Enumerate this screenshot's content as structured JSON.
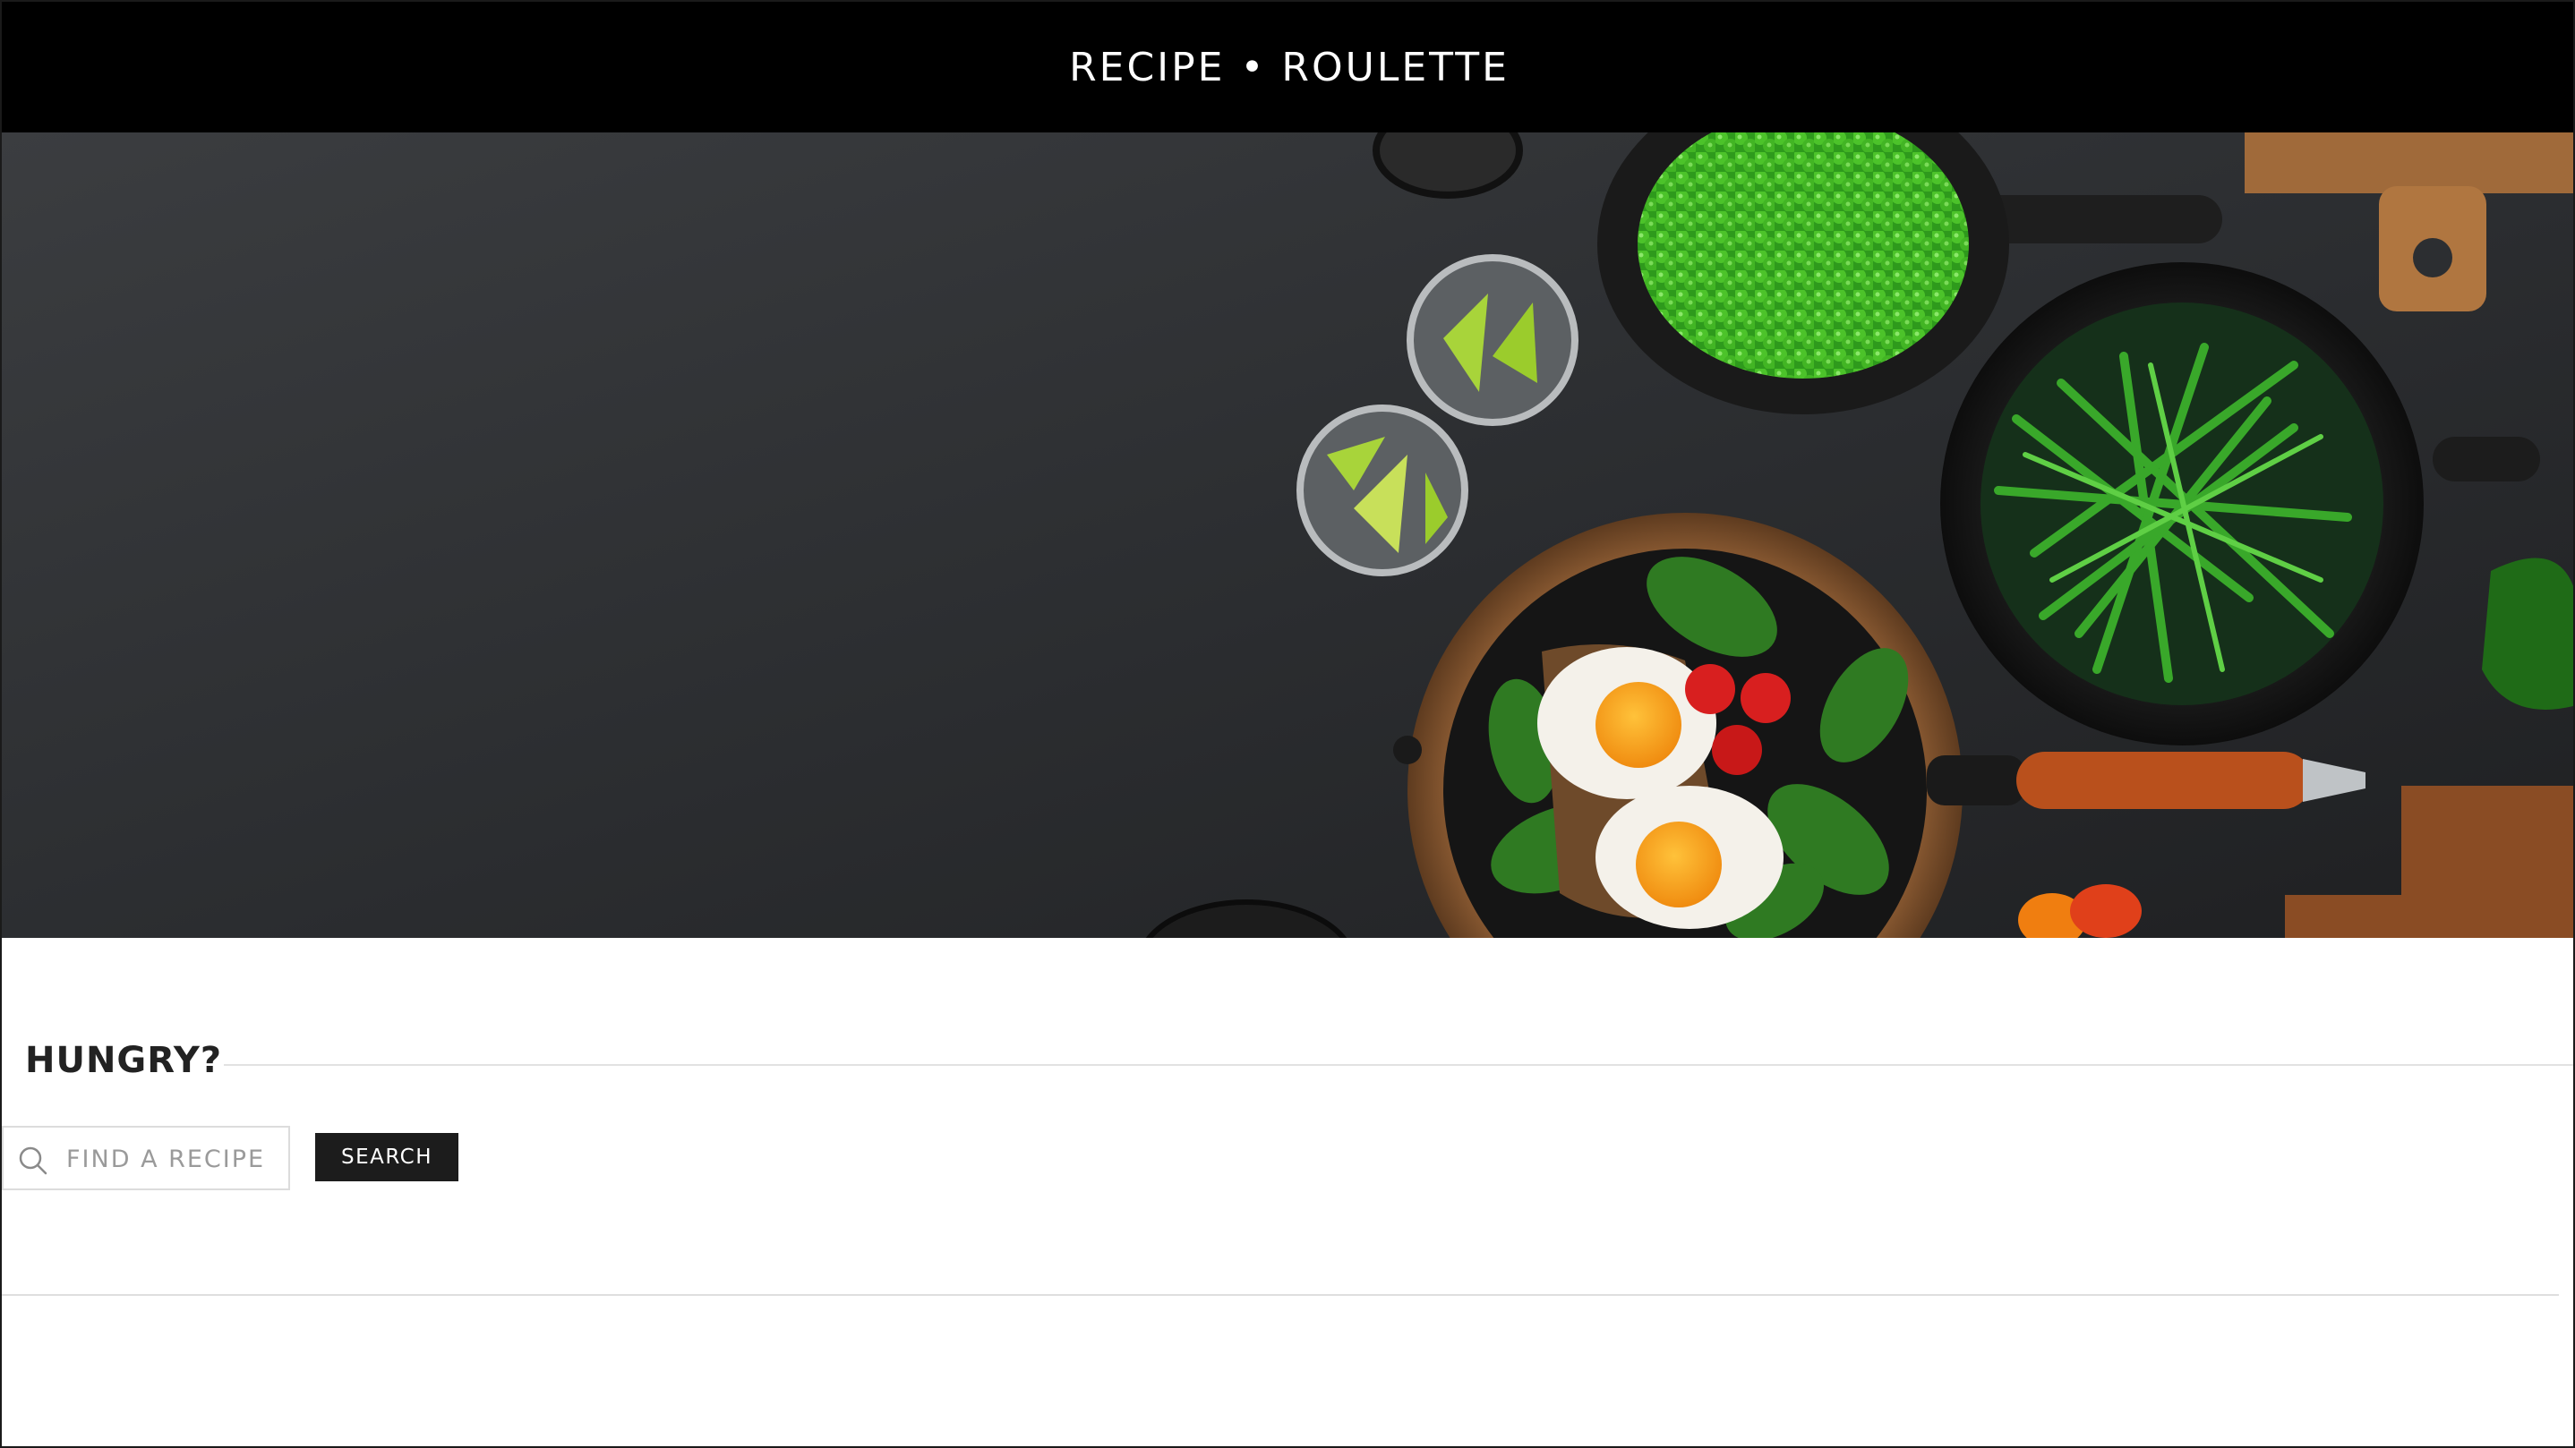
{
  "header": {
    "site_title": "RECIPE • ROULETTE"
  },
  "hero": {
    "image_subject": "overhead kitchen table with cast-iron pans of peas, green beans, fried eggs with spinach and tomatoes, glasses with lime wedges, wooden cutting boards"
  },
  "main": {
    "heading": "HUNGRY?",
    "search": {
      "placeholder": "FIND A RECIPE",
      "value": "",
      "icon": "search-icon",
      "button_label": "SEARCH"
    }
  },
  "colors": {
    "header_bg": "#000000",
    "header_text": "#ffffff",
    "button_bg": "#1c1c1c",
    "button_text": "#ffffff",
    "rule": "#e2e2e2"
  }
}
